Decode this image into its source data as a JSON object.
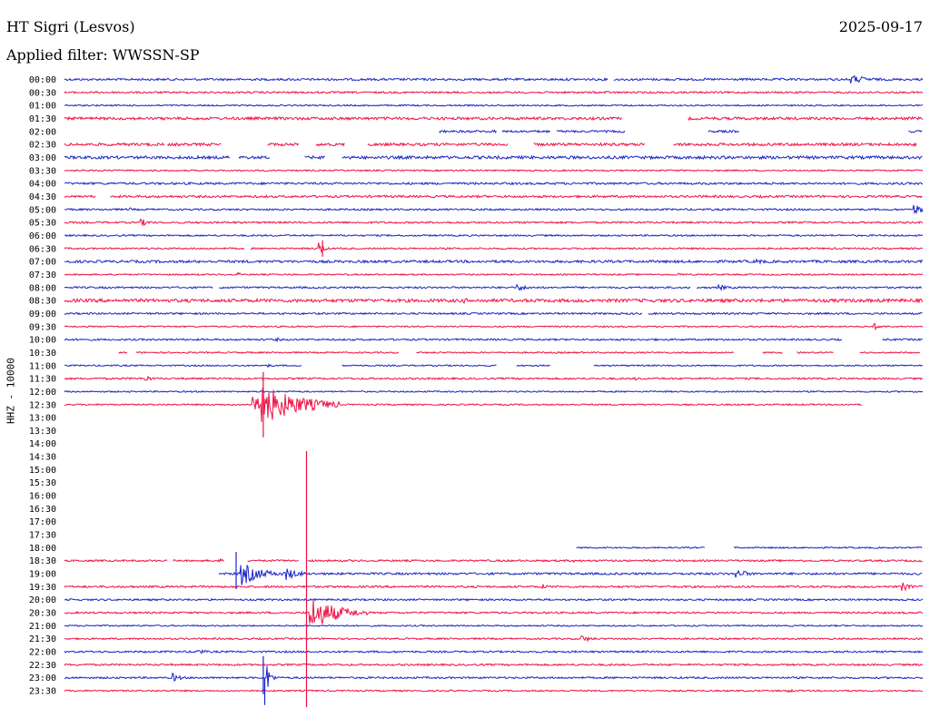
{
  "header": {
    "station": "HT Sigri (Lesvos)",
    "date": "2025-09-17",
    "filter": "Applied filter: WWSSN-SP",
    "channel": "HHZ - 10000"
  },
  "colors": {
    "blue": "#1a23c8",
    "red": "#ee1144"
  },
  "chart_data": {
    "type": "line",
    "title": "HT Sigri (Lesvos)",
    "subtitle": "Applied filter: WWSSN-SP",
    "ylabel": "HHZ - 10000",
    "y_tick_labels": [
      "00:00",
      "00:30",
      "01:00",
      "01:30",
      "02:00",
      "02:30",
      "03:00",
      "03:30",
      "04:00",
      "04:30",
      "05:00",
      "05:30",
      "06:00",
      "06:30",
      "07:00",
      "07:30",
      "08:00",
      "08:30",
      "09:00",
      "09:30",
      "10:00",
      "10:30",
      "11:00",
      "11:30",
      "12:00",
      "12:30",
      "13:00",
      "13:30",
      "14:00",
      "14:30",
      "15:00",
      "15:30",
      "16:00",
      "16:30",
      "17:00",
      "17:30",
      "18:00",
      "18:30",
      "19:00",
      "19:30",
      "20:00",
      "20:30",
      "21:00",
      "21:30",
      "22:00",
      "22:30",
      "23:00",
      "23:30"
    ],
    "x_range_minutes": [
      0,
      30
    ],
    "traces": [
      {
        "row": 0,
        "color": "blue",
        "noise": 1.2,
        "segments": [
          [
            0,
            19.0
          ],
          [
            19.2,
            30
          ]
        ],
        "events": [
          [
            27.5,
            5,
            1.5
          ]
        ]
      },
      {
        "row": 1,
        "color": "red",
        "noise": 1.0,
        "segments": [
          [
            0,
            30
          ]
        ],
        "events": [
          [
            18.9,
            2,
            0.5
          ],
          [
            21.2,
            1.5,
            0.3
          ]
        ]
      },
      {
        "row": 2,
        "color": "blue",
        "noise": 0.8,
        "segments": [
          [
            0,
            30
          ]
        ],
        "events": []
      },
      {
        "row": 3,
        "color": "red",
        "noise": 1.5,
        "segments": [
          [
            0,
            19.5
          ],
          [
            21.8,
            30
          ]
        ],
        "events": []
      },
      {
        "row": 4,
        "color": "blue",
        "noise": 1.2,
        "segments": [
          [
            13.1,
            15.1
          ],
          [
            15.3,
            17.0
          ],
          [
            17.2,
            19.6
          ],
          [
            22.5,
            23.6
          ],
          [
            29.5,
            30
          ]
        ],
        "events": []
      },
      {
        "row": 5,
        "color": "red",
        "noise": 1.5,
        "segments": [
          [
            0,
            3.5
          ],
          [
            3.6,
            5.5
          ],
          [
            7.1,
            8.2
          ],
          [
            8.8,
            9.8
          ],
          [
            10.6,
            15.5
          ],
          [
            16.4,
            20.3
          ],
          [
            21.3,
            29.8
          ]
        ],
        "events": [
          [
            5.9,
            4,
            0.3
          ]
        ]
      },
      {
        "row": 6,
        "color": "blue",
        "noise": 1.6,
        "segments": [
          [
            0,
            5.8
          ],
          [
            6.1,
            7.2
          ],
          [
            8.4,
            9.1
          ],
          [
            9.7,
            30
          ]
        ],
        "events": []
      },
      {
        "row": 7,
        "color": "red",
        "noise": 0.8,
        "segments": [
          [
            0,
            30
          ]
        ],
        "events": [
          [
            1.2,
            2,
            0.5
          ],
          [
            29.1,
            2,
            0.4
          ]
        ]
      },
      {
        "row": 8,
        "color": "blue",
        "noise": 1.2,
        "segments": [
          [
            0,
            30
          ]
        ],
        "events": []
      },
      {
        "row": 9,
        "color": "red",
        "noise": 1.2,
        "segments": [
          [
            0,
            1.1
          ],
          [
            1.6,
            30
          ]
        ],
        "events": []
      },
      {
        "row": 10,
        "color": "blue",
        "noise": 1.0,
        "segments": [
          [
            0,
            30
          ]
        ],
        "events": [
          [
            2.3,
            2,
            0.4
          ],
          [
            29.7,
            6,
            1.2
          ]
        ]
      },
      {
        "row": 11,
        "color": "red",
        "noise": 1.0,
        "segments": [
          [
            0,
            30
          ]
        ],
        "events": [
          [
            2.7,
            4,
            0.7
          ]
        ]
      },
      {
        "row": 12,
        "color": "blue",
        "noise": 0.9,
        "segments": [
          [
            0,
            30
          ]
        ],
        "events": []
      },
      {
        "row": 13,
        "color": "red",
        "noise": 0.9,
        "segments": [
          [
            0,
            6.3
          ],
          [
            6.5,
            30
          ]
        ],
        "events": [
          [
            8.9,
            9,
            0.3
          ]
        ]
      },
      {
        "row": 14,
        "color": "blue",
        "noise": 1.4,
        "segments": [
          [
            0,
            30
          ]
        ],
        "events": [
          [
            24.2,
            3,
            1.0
          ]
        ]
      },
      {
        "row": 15,
        "color": "red",
        "noise": 0.8,
        "segments": [
          [
            0,
            30
          ]
        ],
        "events": [
          [
            6.1,
            2,
            0.4
          ],
          [
            21.5,
            2,
            0.4
          ]
        ]
      },
      {
        "row": 16,
        "color": "blue",
        "noise": 1.0,
        "segments": [
          [
            0,
            5.2
          ],
          [
            5.4,
            21.9
          ],
          [
            22.1,
            30
          ]
        ],
        "events": [
          [
            15.8,
            4,
            1.0
          ],
          [
            22.9,
            3,
            0.8
          ]
        ]
      },
      {
        "row": 17,
        "color": "red",
        "noise": 1.8,
        "segments": [
          [
            0,
            30
          ]
        ],
        "events": [
          [
            14.0,
            3,
            0.6
          ]
        ]
      },
      {
        "row": 18,
        "color": "blue",
        "noise": 1.0,
        "segments": [
          [
            0,
            20.2
          ],
          [
            20.4,
            30
          ]
        ],
        "events": []
      },
      {
        "row": 19,
        "color": "red",
        "noise": 0.8,
        "segments": [
          [
            0,
            30
          ]
        ],
        "events": [
          [
            28.3,
            4,
            0.5
          ]
        ]
      },
      {
        "row": 20,
        "color": "blue",
        "noise": 1.0,
        "segments": [
          [
            0,
            27.2
          ],
          [
            28.6,
            30
          ]
        ],
        "events": [
          [
            7.4,
            2,
            0.7
          ]
        ]
      },
      {
        "row": 21,
        "color": "red",
        "noise": 0.8,
        "segments": [
          [
            1.9,
            2.2
          ],
          [
            2.5,
            11.7
          ],
          [
            12.3,
            23.4
          ],
          [
            24.4,
            25.1
          ],
          [
            25.6,
            26.9
          ],
          [
            27.8,
            29.9
          ]
        ],
        "events": []
      },
      {
        "row": 22,
        "color": "blue",
        "noise": 0.8,
        "segments": [
          [
            0,
            8.3
          ],
          [
            9.7,
            15.1
          ],
          [
            15.8,
            17.0
          ],
          [
            18.5,
            30
          ]
        ],
        "events": [
          [
            7.1,
            2,
            0.5
          ]
        ]
      },
      {
        "row": 23,
        "color": "red",
        "noise": 1.0,
        "segments": [
          [
            0,
            30
          ]
        ],
        "events": [
          [
            2.8,
            4,
            0.6
          ],
          [
            20.0,
            2,
            0.4
          ]
        ]
      },
      {
        "row": 24,
        "color": "blue",
        "noise": 0.8,
        "segments": [
          [
            0,
            30
          ]
        ],
        "events": []
      },
      {
        "row": 25,
        "color": "red",
        "noise": 0.8,
        "segments": [
          [
            0,
            27.9
          ]
        ],
        "events": [
          [
            6.6,
            28,
            3.0
          ]
        ]
      },
      {
        "row": 36,
        "color": "blue",
        "noise": 0.8,
        "segments": [
          [
            17.9,
            22.4
          ],
          [
            23.4,
            30
          ]
        ],
        "events": []
      },
      {
        "row": 37,
        "color": "red",
        "noise": 1.0,
        "segments": [
          [
            0,
            3.6
          ],
          [
            3.8,
            5.6
          ],
          [
            6.4,
            8.2
          ],
          [
            8.5,
            30
          ]
        ],
        "events": [
          [
            5.4,
            3,
            0.3
          ],
          [
            17.8,
            2,
            0.3
          ]
        ]
      },
      {
        "row": 38,
        "color": "blue",
        "noise": 1.2,
        "segments": [
          [
            5.4,
            30
          ]
        ],
        "events": [
          [
            6.2,
            13,
            1.5
          ],
          [
            7.7,
            8,
            1.0
          ],
          [
            23.5,
            5,
            1.0
          ]
        ]
      },
      {
        "row": 39,
        "color": "red",
        "noise": 1.1,
        "segments": [
          [
            0,
            30
          ]
        ],
        "events": [
          [
            16.7,
            3,
            0.6
          ],
          [
            29.3,
            5,
            0.7
          ]
        ]
      },
      {
        "row": 40,
        "color": "blue",
        "noise": 1.0,
        "segments": [
          [
            0,
            30
          ]
        ],
        "events": [
          [
            4.4,
            2,
            0.5
          ]
        ]
      },
      {
        "row": 41,
        "color": "red",
        "noise": 1.0,
        "segments": [
          [
            0,
            30
          ]
        ],
        "events": [
          [
            8.6,
            20,
            2.0
          ]
        ]
      },
      {
        "row": 42,
        "color": "blue",
        "noise": 0.8,
        "segments": [
          [
            0,
            30
          ]
        ],
        "events": []
      },
      {
        "row": 43,
        "color": "red",
        "noise": 0.9,
        "segments": [
          [
            0,
            30
          ]
        ],
        "events": [
          [
            18.1,
            4,
            0.8
          ]
        ]
      },
      {
        "row": 44,
        "color": "blue",
        "noise": 1.0,
        "segments": [
          [
            0,
            30
          ]
        ],
        "events": [
          [
            4.6,
            4,
            0.7
          ]
        ]
      },
      {
        "row": 45,
        "color": "red",
        "noise": 1.0,
        "segments": [
          [
            0,
            30
          ]
        ],
        "events": []
      },
      {
        "row": 46,
        "color": "blue",
        "noise": 1.0,
        "segments": [
          [
            0,
            30
          ]
        ],
        "events": [
          [
            3.8,
            5,
            0.6
          ],
          [
            7.1,
            14,
            0.3
          ]
        ]
      },
      {
        "row": 47,
        "color": "red",
        "noise": 0.8,
        "segments": [
          [
            0,
            30
          ]
        ],
        "events": [
          [
            25.3,
            2,
            0.6
          ]
        ]
      }
    ],
    "spikes": [
      {
        "row": 13,
        "minute": 9.02,
        "color": "red",
        "up": 9,
        "down": 9
      },
      {
        "row": 25,
        "minute": 6.95,
        "color": "red",
        "up": 36,
        "down": 36
      },
      {
        "row": 38,
        "minute": 6.0,
        "color": "blue",
        "up": 24,
        "down": 17
      },
      {
        "row": 41,
        "minute": 8.46,
        "color": "red",
        "up": 178,
        "down": 106
      },
      {
        "row": 46,
        "minute": 6.95,
        "color": "blue",
        "up": 24,
        "down": 18
      },
      {
        "row": 46,
        "minute": 7.0,
        "color": "blue",
        "up": 0,
        "down": 30
      }
    ]
  }
}
